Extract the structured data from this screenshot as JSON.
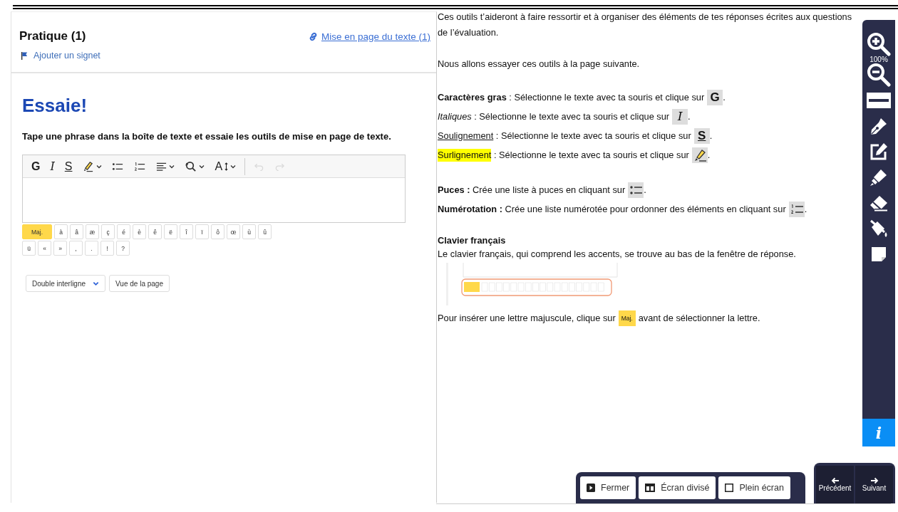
{
  "header": {
    "title": "Pratique (1)",
    "link": "Mise en page du texte (1)",
    "bookmark": "Ajouter un signet"
  },
  "practice": {
    "heading": "Essaie!",
    "instruction": "Tape une phrase dans la boîte de texte et essaie les outils de mise en page de texte.",
    "toolbar": [
      {
        "kind": "bold",
        "label": "G",
        "disabled": false
      },
      {
        "kind": "italic",
        "label": "I",
        "disabled": false
      },
      {
        "kind": "underline",
        "label": "S",
        "disabled": false
      },
      {
        "kind": "highlight",
        "dropdown": true,
        "disabled": false
      },
      {
        "kind": "bullets",
        "disabled": false
      },
      {
        "kind": "numbers",
        "disabled": false
      },
      {
        "kind": "align",
        "dropdown": true,
        "disabled": false
      },
      {
        "kind": "find",
        "dropdown": true,
        "disabled": false
      },
      {
        "kind": "size",
        "label": "A",
        "dropdown": true,
        "disabled": false
      },
      {
        "kind": "undo",
        "disabled": true
      },
      {
        "kind": "redo",
        "disabled": true
      }
    ],
    "key_rows": [
      [
        {
          "kind": "shift",
          "label": "Maj."
        },
        {
          "kind": "char",
          "label": "à"
        },
        {
          "kind": "char",
          "label": "â"
        },
        {
          "kind": "char",
          "label": "æ"
        },
        {
          "kind": "char",
          "label": "ç"
        },
        {
          "kind": "char",
          "label": "é"
        },
        {
          "kind": "char",
          "label": "è"
        },
        {
          "kind": "char",
          "label": "ê"
        },
        {
          "kind": "char",
          "label": "ë"
        },
        {
          "kind": "char",
          "label": "î"
        },
        {
          "kind": "char",
          "label": "ï"
        },
        {
          "kind": "char",
          "label": "ô"
        },
        {
          "kind": "char",
          "label": "œ"
        },
        {
          "kind": "char",
          "label": "ù"
        },
        {
          "kind": "char",
          "label": "û"
        }
      ],
      [
        {
          "kind": "char",
          "label": "ü"
        },
        {
          "kind": "char",
          "label": "«"
        },
        {
          "kind": "char",
          "label": "»"
        },
        {
          "kind": "char",
          "label": ","
        },
        {
          "kind": "char",
          "label": "."
        },
        {
          "kind": "char",
          "label": "!"
        },
        {
          "kind": "char",
          "label": "?"
        }
      ]
    ],
    "line_spacing": "Double interligne",
    "page_view": "Vue de la page"
  },
  "instructions": {
    "intro": [
      "Ces outils t’aideront à faire ressortir et à organiser des éléments de tes réponses écrites aux questions de l’évaluation.",
      "Nous allons essayer ces outils à la page suivante."
    ],
    "format_items": [
      {
        "kind": "bold",
        "term": "Caractères gras",
        "text": " : Sélectionne le texte avec ta souris et clique sur",
        "icon": {
          "kind": "letter",
          "label": "G"
        },
        "after": "."
      },
      {
        "kind": "italic",
        "term": "Italiques",
        "text": " : Sélectionne le texte avec ta souris et clique sur",
        "icon": {
          "kind": "italic-letter",
          "label": "I"
        },
        "after": "."
      },
      {
        "kind": "underline",
        "term": "Soulignement",
        "text": " : Sélectionne le texte avec ta souris et clique sur",
        "icon": {
          "kind": "underline-letter",
          "label": "S"
        },
        "after": "."
      },
      {
        "kind": "highlight",
        "term": "Surlignement",
        "text": " : Sélectionne le texte avec ta souris et clique sur",
        "icon": {
          "kind": "highlighter"
        },
        "after": "."
      }
    ],
    "list_items": [
      {
        "kind": "bold",
        "term": "Puces :",
        "text": " Crée une liste à puces en cliquant sur",
        "icon": {
          "kind": "bullets"
        },
        "after": "."
      },
      {
        "kind": "bold",
        "term": "Numérotation :",
        "text": " Crée une liste numérotée pour ordonner des éléments en cliquant sur",
        "icon": {
          "kind": "numbers"
        },
        "after": "."
      }
    ],
    "keyboard_title": "Clavier français",
    "keyboard_text": "Le clavier français, qui comprend les accents, se trouve au bas de la fenêtre de réponse.",
    "shift_before": "Pour insérer une lettre majuscule, clique sur",
    "shift_key": "Maj.",
    "shift_after": "avant de sélectionner la lettre."
  },
  "side_toolbar": [
    {
      "kind": "zoom-in"
    },
    {
      "kind": "zoom-label",
      "label": "100%"
    },
    {
      "kind": "zoom-out"
    },
    {
      "kind": "line-reader"
    },
    {
      "kind": "pen"
    },
    {
      "kind": "edit"
    },
    {
      "kind": "highlighter"
    },
    {
      "kind": "eraser"
    },
    {
      "kind": "fill"
    },
    {
      "kind": "sticky-note"
    }
  ],
  "info_button": "i",
  "view_buttons": [
    {
      "kind": "close",
      "label": "Fermer"
    },
    {
      "kind": "split",
      "label": "Écran divisé"
    },
    {
      "kind": "full",
      "label": "Plein écran"
    }
  ],
  "nav_buttons": [
    {
      "kind": "prev",
      "label": "Précédent"
    },
    {
      "kind": "next",
      "label": "Suivant"
    }
  ]
}
